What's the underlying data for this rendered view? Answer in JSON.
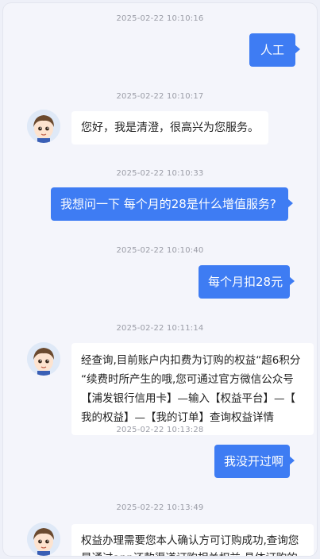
{
  "messages": [
    {
      "timestamp": "2025-02-22 10:10:16",
      "from": "user",
      "text": "人工"
    },
    {
      "timestamp": "2025-02-22 10:10:17",
      "from": "agent",
      "text": "您好，我是清澄，很高兴为您服务。"
    },
    {
      "timestamp": "2025-02-22 10:10:33",
      "from": "user",
      "text": "我想问一下 每个月的28是什么增值服务?"
    },
    {
      "timestamp": "2025-02-22 10:10:40",
      "from": "user",
      "text": "每个月扣28元"
    },
    {
      "timestamp": "2025-02-22 10:11:14",
      "from": "agent",
      "lines": [
        "经查询,目前账户内扣费为订购的权益“超6积分",
        "“续费时所产生的哦,您可通过官方微信公众号",
        "【浦发银行信用卡】—输入【权益平台】—【",
        "我的权益】—【我的订单】查询权益详情"
      ]
    },
    {
      "timestamp": "2025-02-22 10:13:28",
      "from": "user",
      "text": "我没开过啊"
    },
    {
      "timestamp": "2025-02-22 10:13:49",
      "from": "agent",
      "lines": [
        "权益办理需要您本人确认方可订购成功,查询您",
        "是通过app还款渠道订购相关权益,具体订购的"
      ]
    }
  ],
  "colors": {
    "user_bubble": "#3e7cf3",
    "agent_bubble": "#ffffff",
    "background": "#f4f5fb"
  },
  "icons": {
    "agent_avatar": "cartoon-boy-avatar-icon"
  }
}
